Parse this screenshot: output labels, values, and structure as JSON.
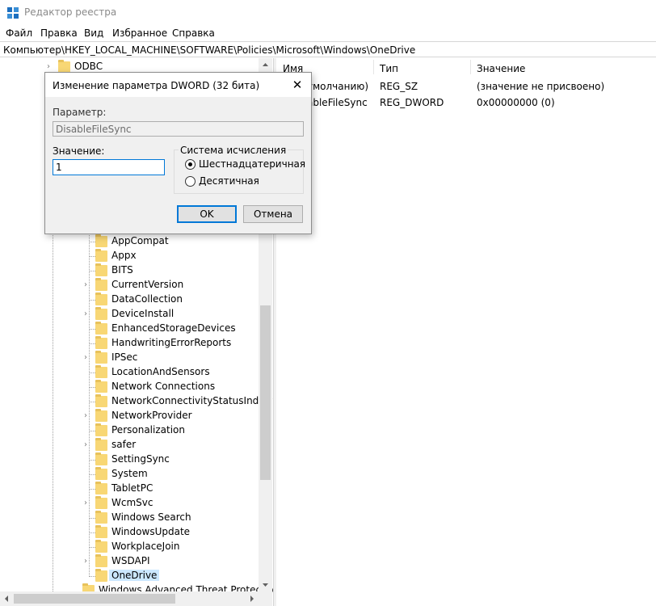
{
  "window": {
    "title": "Редактор реестра"
  },
  "menu": [
    "Файл",
    "Правка",
    "Вид",
    "Избранное",
    "Справка"
  ],
  "address": "Компьютер\\HKEY_LOCAL_MACHINE\\SOFTWARE\\Policies\\Microsoft\\Windows\\OneDrive",
  "tree": {
    "top_item": "ODBC",
    "items": [
      {
        "label": "AppCompat",
        "expandable": false
      },
      {
        "label": "Appx",
        "expandable": false
      },
      {
        "label": "BITS",
        "expandable": false
      },
      {
        "label": "CurrentVersion",
        "expandable": true
      },
      {
        "label": "DataCollection",
        "expandable": false
      },
      {
        "label": "DeviceInstall",
        "expandable": true
      },
      {
        "label": "EnhancedStorageDevices",
        "expandable": false
      },
      {
        "label": "HandwritingErrorReports",
        "expandable": false
      },
      {
        "label": "IPSec",
        "expandable": true
      },
      {
        "label": "LocationAndSensors",
        "expandable": false
      },
      {
        "label": "Network Connections",
        "expandable": false
      },
      {
        "label": "NetworkConnectivityStatusIndicat",
        "expandable": false
      },
      {
        "label": "NetworkProvider",
        "expandable": true
      },
      {
        "label": "Personalization",
        "expandable": false
      },
      {
        "label": "safer",
        "expandable": true
      },
      {
        "label": "SettingSync",
        "expandable": false
      },
      {
        "label": "System",
        "expandable": false
      },
      {
        "label": "TabletPC",
        "expandable": false
      },
      {
        "label": "WcmSvc",
        "expandable": true
      },
      {
        "label": "Windows Search",
        "expandable": false
      },
      {
        "label": "WindowsUpdate",
        "expandable": false
      },
      {
        "label": "WorkplaceJoin",
        "expandable": false
      },
      {
        "label": "WSDAPI",
        "expandable": true
      },
      {
        "label": "OneDrive",
        "expandable": false,
        "selected": true
      }
    ],
    "bottom_item": "Windows Advanced Threat Protection"
  },
  "values": {
    "headers": {
      "name": "Имя",
      "type": "Тип",
      "data": "Значение"
    },
    "rows": [
      {
        "name": "(По умолчанию)",
        "name_visible": "умолчанию)",
        "type": "REG_SZ",
        "data": "(значение не присвоено)"
      },
      {
        "name": "DisableFileSync",
        "name_visible": "ableFileSync",
        "type": "REG_DWORD",
        "data": "0x00000000 (0)"
      }
    ]
  },
  "dialog": {
    "title": "Изменение параметра DWORD (32 бита)",
    "close_glyph": "✕",
    "param_label": "Параметр:",
    "param_value": "DisableFileSync",
    "value_label": "Значение:",
    "value_input": "1",
    "base_group": "Система исчисления",
    "radio_hex": "Шестнадцатеричная",
    "radio_dec": "Десятичная",
    "ok": "OK",
    "cancel": "Отмена"
  },
  "colors": {
    "selection": "#cce8ff",
    "accent": "#0078d7",
    "folder": "#f8d775"
  }
}
